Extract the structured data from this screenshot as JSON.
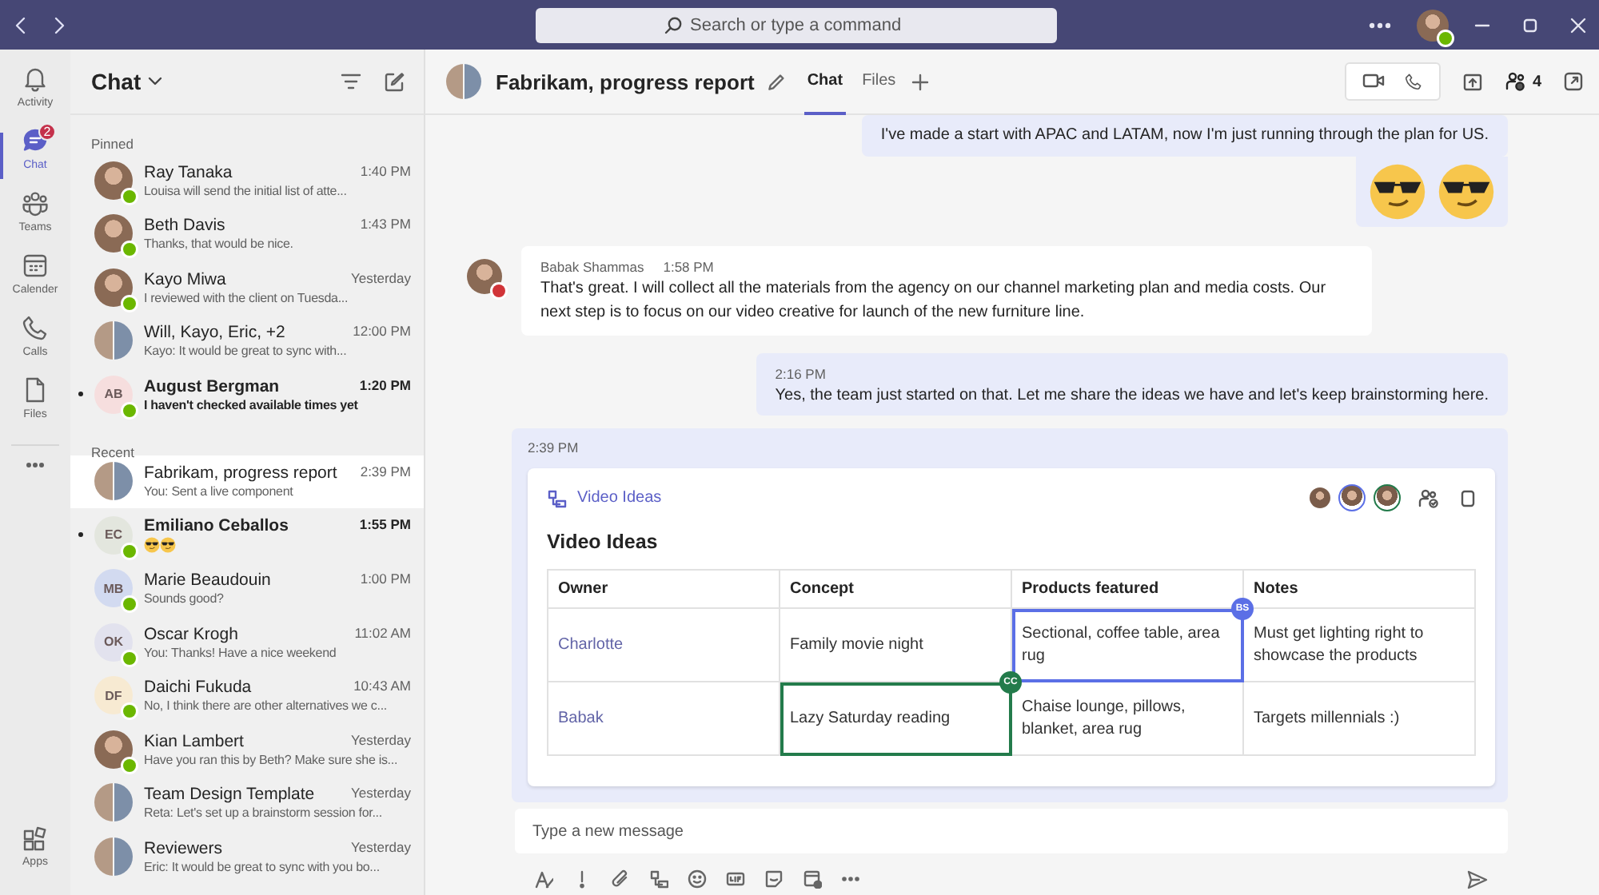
{
  "titlebar": {
    "search": {
      "placeholder": "Search or type a command"
    },
    "user": {
      "presence": {
        "color": "#6bb700"
      }
    }
  },
  "rail": {
    "items": [
      {
        "label": "Activity",
        "selected": false
      },
      {
        "label": "Chat",
        "selected": true,
        "badge": "2"
      },
      {
        "label": "Teams",
        "selected": false
      },
      {
        "label": "Calender",
        "selected": false
      },
      {
        "label": "Calls",
        "selected": false
      },
      {
        "label": "Files",
        "selected": false
      }
    ],
    "apps": {
      "label": "Apps"
    }
  },
  "chat_list": {
    "title": "Chat",
    "sections": [
      {
        "label": "Pinned",
        "items": [
          {
            "name": "Ray Tanaka",
            "time": "1:40 PM",
            "preview": "Louisa will send the initial list of atte...",
            "unread": false,
            "selected": false,
            "avatar": {
              "kind": "photo"
            },
            "presence": {
              "color": "#6bb700"
            }
          },
          {
            "name": "Beth Davis",
            "time": "1:43 PM",
            "preview": "Thanks, that would be nice.",
            "unread": false,
            "selected": false,
            "avatar": {
              "kind": "photo"
            },
            "presence": {
              "color": "#6bb700"
            }
          },
          {
            "name": "Kayo Miwa",
            "time": "Yesterday",
            "preview": "I reviewed with the client on Tuesda...",
            "unread": false,
            "selected": false,
            "avatar": {
              "kind": "photo"
            },
            "presence": {
              "color": "#6bb700"
            }
          },
          {
            "name": "Will, Kayo, Eric, +2",
            "time": "12:00 PM",
            "preview": "Kayo: It would be great to sync with...",
            "unread": false,
            "selected": false,
            "avatar": {
              "kind": "group"
            }
          },
          {
            "name": "August Bergman",
            "time": "1:20 PM",
            "preview": "I haven't checked available times yet",
            "unread": true,
            "selected": false,
            "avatar": {
              "kind": "initials",
              "initials": "AB",
              "color": "#f6dede"
            },
            "presence": {
              "color": "#6bb700"
            }
          }
        ]
      },
      {
        "label": "Recent",
        "items": [
          {
            "name": "Fabrikam, progress report",
            "time": "2:39 PM",
            "preview": "You: Sent a live component",
            "unread": false,
            "selected": true,
            "avatar": {
              "kind": "group"
            }
          },
          {
            "name": "Emiliano Ceballos",
            "time": "1:55 PM",
            "preview_emojis": [
              {
                "kind": "sunglasses"
              },
              {
                "kind": "sunglasses"
              }
            ],
            "unread": true,
            "selected": false,
            "avatar": {
              "kind": "initials",
              "initials": "EC",
              "color": "#e3e6de"
            },
            "presence": {
              "color": "#6bb700"
            }
          },
          {
            "name": "Marie Beaudouin",
            "time": "1:00 PM",
            "preview": "Sounds good?",
            "unread": false,
            "selected": false,
            "avatar": {
              "kind": "initials",
              "initials": "MB",
              "color": "#d2daf0"
            },
            "presence": {
              "color": "#6bb700"
            }
          },
          {
            "name": "Oscar Krogh",
            "time": "11:02 AM",
            "preview": "You: Thanks! Have a nice weekend",
            "unread": false,
            "selected": false,
            "avatar": {
              "kind": "initials",
              "initials": "OK",
              "color": "#e2e2ee"
            },
            "presence": {
              "color": "#6bb700"
            }
          },
          {
            "name": "Daichi Fukuda",
            "time": "10:43 AM",
            "preview": "No, I think there are other alternatives we c...",
            "unread": false,
            "selected": false,
            "avatar": {
              "kind": "initials",
              "initials": "DF",
              "color": "#f7ead2"
            },
            "presence": {
              "color": "#6bb700"
            }
          },
          {
            "name": "Kian Lambert",
            "time": "Yesterday",
            "preview": "Have you ran this by Beth? Make sure she is...",
            "unread": false,
            "selected": false,
            "avatar": {
              "kind": "photo"
            },
            "presence": {
              "color": "#6bb700"
            }
          },
          {
            "name": "Team Design Template",
            "time": "Yesterday",
            "preview": "Reta: Let's set up a brainstorm session for...",
            "unread": false,
            "selected": false,
            "avatar": {
              "kind": "group"
            }
          },
          {
            "name": "Reviewers",
            "time": "Yesterday",
            "preview": "Eric: It would be great to sync with you bo...",
            "unread": false,
            "selected": false,
            "avatar": {
              "kind": "group"
            }
          }
        ]
      }
    ]
  },
  "conversation": {
    "title": "Fabrikam, progress report",
    "tabs": [
      {
        "label": "Chat",
        "selected": true
      },
      {
        "label": "Files",
        "selected": false
      }
    ],
    "participants_count": "4",
    "messages": [
      {
        "kind": "sent",
        "text": "I've made a start with APAC and LATAM, now I'm just running through the plan for US."
      },
      {
        "kind": "emoji",
        "emojis": [
          {
            "kind": "sunglasses"
          },
          {
            "kind": "sunglasses"
          }
        ]
      },
      {
        "kind": "received",
        "author": "Babak Shammas",
        "time": "1:58 PM",
        "presence": {
          "color": "#d13438"
        },
        "text": "That's great. I will collect all the materials from the agency on our channel marketing plan and media costs. Our next step is to focus on our video creative for launch of the new furniture line."
      },
      {
        "kind": "sent",
        "time": "2:16 PM",
        "text": "Yes, the team just started on that. Let me share the ideas we have and let's keep brainstorming here."
      },
      {
        "kind": "card",
        "time": "2:39 PM",
        "card": {
          "link": "Video Ideas",
          "title": "Video Ideas",
          "collaborators": [
            {
              "kind": "photo"
            },
            {
              "kind": "photo",
              "color": "#5b6fe6"
            },
            {
              "kind": "photo",
              "color": "#237b4b"
            }
          ],
          "columns": [
            "Owner",
            "Concept",
            "Products featured",
            "Notes"
          ],
          "rows": [
            {
              "cells": [
                {
                  "text": "Charlotte",
                  "kind": "person"
                },
                {
                  "text": "Family movie night",
                  "kind": "text"
                },
                {
                  "text": "Sectional, coffee table, area rug",
                  "kind": "text",
                  "editor": {
                    "initials": "BS",
                    "color": "#5b6fe6"
                  }
                },
                {
                  "text": "Must get lighting right to showcase the products",
                  "kind": "text"
                }
              ]
            },
            {
              "cells": [
                {
                  "text": "Babak",
                  "kind": "person"
                },
                {
                  "text": "Lazy Saturday reading",
                  "kind": "text",
                  "editor": {
                    "initials": "CC",
                    "color": "#237b4b"
                  }
                },
                {
                  "text": "Chaise lounge, pillows, blanket, area rug",
                  "kind": "text"
                },
                {
                  "text": "Targets millennials :)",
                  "kind": "text"
                }
              ]
            }
          ]
        }
      }
    ],
    "composer": {
      "placeholder": "Type a new message"
    }
  }
}
